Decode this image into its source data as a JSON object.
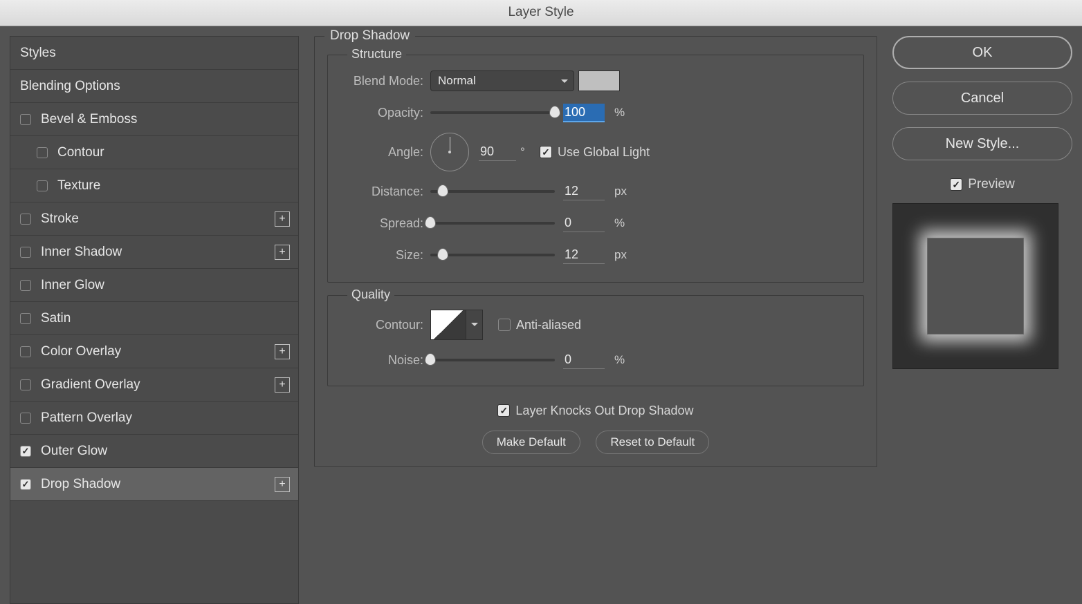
{
  "window_title": "Layer Style",
  "sidebar": {
    "items": [
      {
        "label": "Styles",
        "has_checkbox": false
      },
      {
        "label": "Blending Options",
        "has_checkbox": false
      },
      {
        "label": "Bevel & Emboss",
        "has_checkbox": true,
        "checked": false
      },
      {
        "label": "Contour",
        "has_checkbox": true,
        "checked": false,
        "indent": true
      },
      {
        "label": "Texture",
        "has_checkbox": true,
        "checked": false,
        "indent": true
      },
      {
        "label": "Stroke",
        "has_checkbox": true,
        "checked": false,
        "plus": true
      },
      {
        "label": "Inner Shadow",
        "has_checkbox": true,
        "checked": false,
        "plus": true
      },
      {
        "label": "Inner Glow",
        "has_checkbox": true,
        "checked": false
      },
      {
        "label": "Satin",
        "has_checkbox": true,
        "checked": false
      },
      {
        "label": "Color Overlay",
        "has_checkbox": true,
        "checked": false,
        "plus": true
      },
      {
        "label": "Gradient Overlay",
        "has_checkbox": true,
        "checked": false,
        "plus": true
      },
      {
        "label": "Pattern Overlay",
        "has_checkbox": true,
        "checked": false
      },
      {
        "label": "Outer Glow",
        "has_checkbox": true,
        "checked": true
      },
      {
        "label": "Drop Shadow",
        "has_checkbox": true,
        "checked": true,
        "plus": true,
        "selected": true
      }
    ]
  },
  "panel": {
    "title": "Drop Shadow",
    "structure_title": "Structure",
    "blend_mode_label": "Blend Mode:",
    "blend_mode_value": "Normal",
    "color_swatch": "#bfbfbf",
    "opacity_label": "Opacity:",
    "opacity_value": "100",
    "opacity_unit": "%",
    "angle_label": "Angle:",
    "angle_value": "90",
    "angle_unit": "°",
    "use_global_light_label": "Use Global Light",
    "use_global_light_checked": true,
    "distance_label": "Distance:",
    "distance_value": "12",
    "distance_unit": "px",
    "spread_label": "Spread:",
    "spread_value": "0",
    "spread_unit": "%",
    "size_label": "Size:",
    "size_value": "12",
    "size_unit": "px",
    "quality_title": "Quality",
    "contour_label": "Contour:",
    "anti_aliased_label": "Anti-aliased",
    "anti_aliased_checked": false,
    "noise_label": "Noise:",
    "noise_value": "0",
    "noise_unit": "%",
    "knockout_label": "Layer Knocks Out Drop Shadow",
    "knockout_checked": true,
    "make_default_label": "Make Default",
    "reset_default_label": "Reset to Default"
  },
  "right": {
    "ok": "OK",
    "cancel": "Cancel",
    "new_style": "New Style...",
    "preview_label": "Preview",
    "preview_checked": true
  }
}
